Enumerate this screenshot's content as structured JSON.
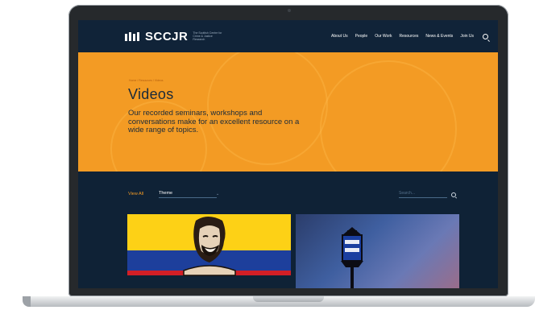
{
  "header": {
    "logo_text": "SCCJR",
    "logo_subtitle": "The Scottish Centre for Crime & Justice Research",
    "nav": [
      "About Us",
      "People",
      "Our Work",
      "Resources",
      "News & Events",
      "Join Us"
    ]
  },
  "hero": {
    "breadcrumb": "Home / Resources / Videos",
    "title": "Videos",
    "description": "Our recorded seminars, workshops and conversations make for an excellent resource on a wide range of topics."
  },
  "filters": {
    "view_all": "View All",
    "theme_label": "Theme",
    "search_placeholder": "Search..."
  },
  "colors": {
    "navy": "#0f2236",
    "orange": "#f39b24",
    "flag_yellow": "#fdd116",
    "flag_blue": "#1d3f9c",
    "flag_red": "#d21f26"
  },
  "cards": [
    {
      "image": "portrait-over-colombian-flag"
    },
    {
      "image": "police-box-lamp"
    }
  ]
}
